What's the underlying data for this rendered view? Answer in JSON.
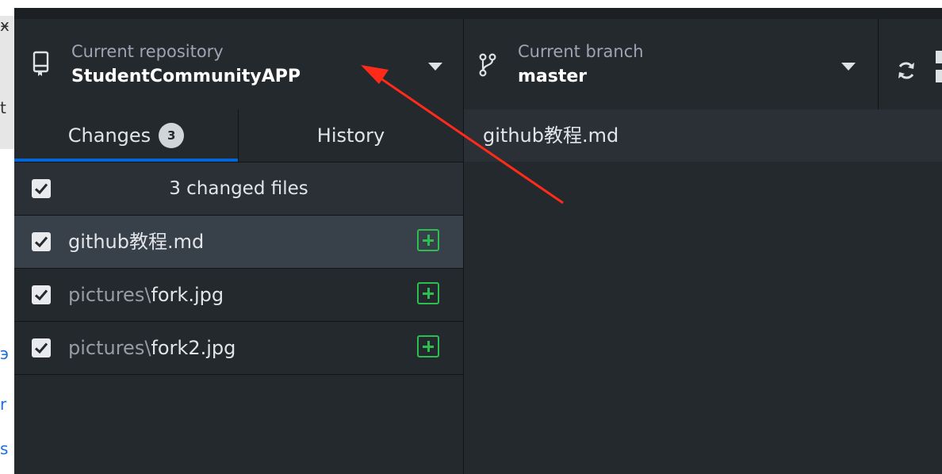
{
  "background": {
    "fragments": [
      "ӿ",
      "t",
      "э",
      "r",
      "s"
    ]
  },
  "toolbar": {
    "repository": {
      "description": "Current repository",
      "title": "StudentCommunityAPP",
      "icon": "repo-icon"
    },
    "branch": {
      "description": "Current branch",
      "title": "master",
      "icon": "git-branch-icon"
    },
    "fetch": {
      "icon": "sync-icon"
    }
  },
  "sidebar": {
    "tabs": [
      {
        "label": "Changes",
        "count": "3",
        "active": true
      },
      {
        "label": "History",
        "active": false
      }
    ],
    "changes_header": {
      "label": "3 changed files",
      "checked": true
    },
    "files": [
      {
        "dir": "",
        "name": "github教程.md",
        "status": "added",
        "checked": true,
        "selected": true
      },
      {
        "dir": "pictures\\",
        "name": "fork.jpg",
        "status": "added",
        "checked": true,
        "selected": false
      },
      {
        "dir": "pictures\\",
        "name": "fork2.jpg",
        "status": "added",
        "checked": true,
        "selected": false
      }
    ]
  },
  "diff": {
    "title": "github教程.md"
  },
  "colors": {
    "app_bg": "#24292e",
    "accent": "#0366d6",
    "added": "#2cbe4e",
    "annotation_arrow": "#ff2a1a"
  }
}
